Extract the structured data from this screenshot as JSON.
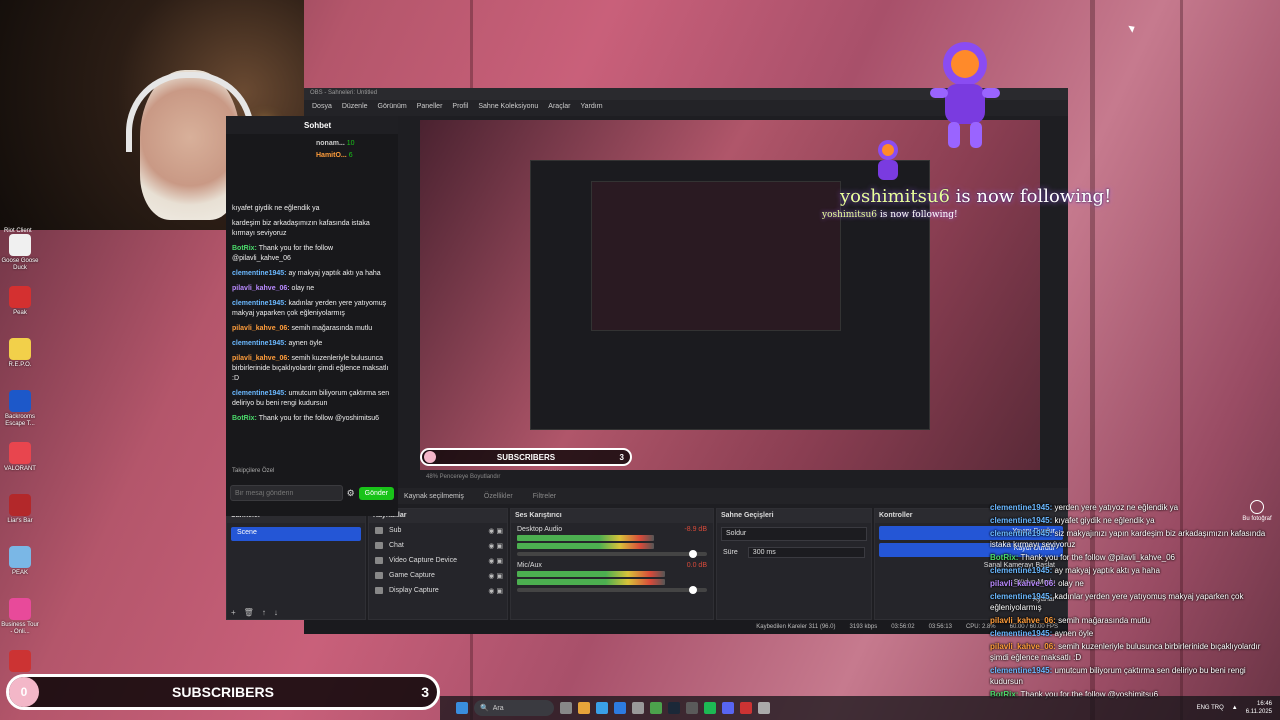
{
  "webcam": {
    "label": "webcam"
  },
  "desktop": {
    "top_label": "Riot Client",
    "icons": [
      {
        "label": "Goose Goose Duck",
        "color": "#f0f0f0"
      },
      {
        "label": "Peak",
        "color": "#d43030"
      },
      {
        "label": "R.E.P.O.",
        "color": "#f2d04a"
      },
      {
        "label": "Backrooms Escape T...",
        "color": "#1d58c9"
      },
      {
        "label": "VALORANT",
        "color": "#e8454e"
      },
      {
        "label": "Liar's Bar",
        "color": "#b3282a"
      },
      {
        "label": "PEAK",
        "color": "#7ab7e6"
      },
      {
        "label": "Business Tour - Onli...",
        "color": "#e84a9a"
      },
      {
        "label": "",
        "color": "#c33"
      }
    ]
  },
  "chat": {
    "header": "Sohbet",
    "viewers": [
      {
        "name": "nonam...",
        "count": "10",
        "color": "#ccc"
      },
      {
        "name": "HamitO...",
        "count": "6",
        "color": "#ff9d3b"
      }
    ],
    "messages": [
      {
        "user": "",
        "text": "kıyafet giydik ne eğlendik ya",
        "color": "#ccc"
      },
      {
        "user": "",
        "text": "kardeşim biz arkadaşımızın kafasında istaka kırmayı seviyoruz",
        "color": "#ccc"
      },
      {
        "user": "BotRix:",
        "text": "Thank you for the follow @pilavli_kahve_06",
        "color": "#4ad96a"
      },
      {
        "user": "clementine1945:",
        "text": "ay makyaj yaptık aktı ya haha",
        "color": "#6ab8ff"
      },
      {
        "user": "pilavli_kahve_06:",
        "text": "olay ne",
        "color": "#b98aff"
      },
      {
        "user": "clementine1945:",
        "text": "kadınlar yerden yere yatıyomuş makyaj yaparken çok eğleniyolarmış",
        "color": "#6ab8ff"
      },
      {
        "user": "pilavli_kahve_06:",
        "text": "semih mağarasında mutlu",
        "color": "#ff9d3b"
      },
      {
        "user": "clementine1945:",
        "text": "aynen öyle",
        "color": "#6ab8ff"
      },
      {
        "user": "pilavli_kahve_06:",
        "text": "semih kuzenleriyle bulusunca birbirlerinide bıçaklıyolardır şimdi eğlence maksatlı :D",
        "color": "#ff9d3b"
      },
      {
        "user": "clementine1945:",
        "text": "umutcum biliyorum çaktırma sen deliriyo bu beni rengi kudursun",
        "color": "#6ab8ff"
      },
      {
        "user": "BotRix:",
        "text": "Thank you for the follow @yoshimitsu6",
        "color": "#4ad96a"
      }
    ],
    "followers_label": "Takipçilere Özel",
    "input_placeholder": "Bir mesaj gönderin",
    "send_label": "Gönder"
  },
  "obs": {
    "title": "OBS - Sahneleri: Untitled",
    "menu": [
      "Dosya",
      "Düzenle",
      "Görünüm",
      "Paneller",
      "Profil",
      "Sahne Koleksiyonu",
      "Araçlar",
      "Yardım"
    ],
    "preview_status": "48%   Pencereye Boyutlandır",
    "source_bar": {
      "no_source": "Kaynak seçilmemiş",
      "properties": "Özellikler",
      "filters": "Filtreler"
    },
    "docks": {
      "scenes": {
        "title": "Sahneler",
        "items": [
          "Scene"
        ]
      },
      "sources": {
        "title": "Kaynaklar",
        "items": [
          "Sub",
          "Chat",
          "Video Capture Device",
          "Game Capture",
          "Display Capture"
        ]
      },
      "mixer": {
        "title": "Ses Karıştırıcı",
        "channels": [
          {
            "name": "Desktop Audio",
            "db": "-8.9 dB",
            "level": 0.72
          },
          {
            "name": "Mic/Aux",
            "db": "0.0 dB",
            "level": 0.78
          }
        ]
      },
      "transitions": {
        "title": "Sahne Geçişleri",
        "type": "Soldur",
        "duration_label": "Süre",
        "duration_value": "300 ms"
      },
      "controls": {
        "title": "Kontroller",
        "buttons": [
          "Yayını Durdur",
          "Kaydı Durdur",
          "Sanal Kamerayı Başlat",
          "Stüdyo Modu",
          "Ayarlar"
        ]
      }
    },
    "statusbar": {
      "dropped": "Kaybedilen Kareler 311 (96.0)",
      "bitrate": "3193 kbps",
      "stream_time": "03:56:02",
      "rec_time": "03:56:13",
      "cpu": "CPU: 2.8%",
      "fps": "60.00 / 60.00 FPS"
    }
  },
  "alert": {
    "username": "yoshimitsu6",
    "text": " is now following!"
  },
  "mini_sub": {
    "title": "SUBSCRIBERS",
    "count": "3"
  },
  "right_chat": [
    {
      "user": "clementine1945:",
      "text": "yerden yere yatıyoz ne eğlendik ya",
      "color": "#6ab8ff"
    },
    {
      "user": "clementine1945:",
      "text": "kıyafet giydik ne eğlendik ya",
      "color": "#6ab8ff"
    },
    {
      "user": "clementine1945:",
      "text": "siz makyajınızı yapın kardeşim biz arkadaşımızın kafasında istaka kırmayı seviyoruz",
      "color": "#6ab8ff"
    },
    {
      "user": "BotRix:",
      "text": "Thank you for the follow @pilavli_kahve_06",
      "color": "#4ad96a"
    },
    {
      "user": "clementine1945:",
      "text": "ay makyaj yaptık aktı ya haha",
      "color": "#6ab8ff"
    },
    {
      "user": "pilavli_kahve_06:",
      "text": "olay ne",
      "color": "#b98aff"
    },
    {
      "user": "clementine1945:",
      "text": "kadınlar yerden yere yatıyomuş makyaj yaparken çok eğleniyolarmış",
      "color": "#6ab8ff"
    },
    {
      "user": "pilavli_kahve_06:",
      "text": "semih mağarasında mutlu",
      "color": "#ff9d3b"
    },
    {
      "user": "clementine1945:",
      "text": "aynen öyle",
      "color": "#6ab8ff"
    },
    {
      "user": "pilavli_kahve_06:",
      "text": "semih kuzenleriyle bulusunca birbirlerinide bıçaklıyolardır şimdi eğlence maksatlı :D",
      "color": "#ff9d3b"
    },
    {
      "user": "clementine1945:",
      "text": "umutcum biliyorum çaktırma sen deliriyo bu beni rengi kudursun",
      "color": "#6ab8ff"
    },
    {
      "user": "BotRix:",
      "text": "Thank you for the follow @yoshimitsu6",
      "color": "#4ad96a"
    }
  ],
  "sub_bar": {
    "bubble": "0",
    "title": "SUBSCRIBERS",
    "count": "3"
  },
  "taskbar": {
    "search": "Ara",
    "lang": "ENG TRQ",
    "time": "16:46",
    "date": "6.11.2025"
  },
  "right_badge": {
    "label": "Bu fotoğraf"
  }
}
